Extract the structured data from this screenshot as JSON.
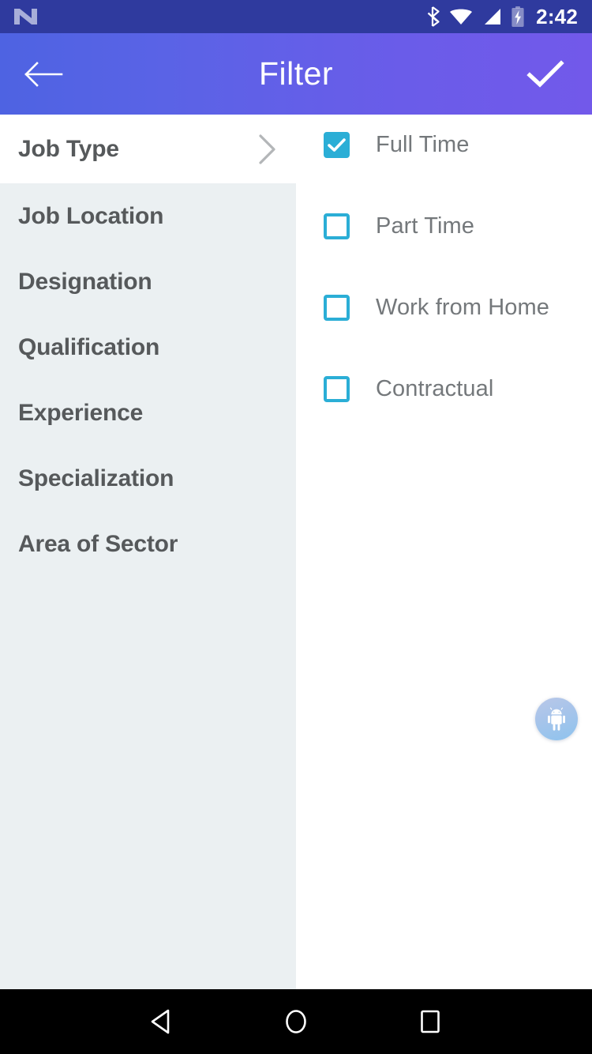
{
  "status_bar": {
    "logo_icon": "android-n-logo-icon",
    "bluetooth_icon": "bluetooth-icon",
    "wifi_icon": "wifi-icon",
    "cellular_icon": "cellular-signal-icon",
    "battery_icon": "battery-charging-icon",
    "clock": "2:42",
    "background_color": "#2f3a9e"
  },
  "app_bar": {
    "title": "Filter",
    "back_icon": "arrow-left-icon",
    "apply_icon": "check-icon",
    "gradient_start": "#4e63e2",
    "gradient_end": "#7259ea"
  },
  "sidebar": {
    "background_color": "#ebf0f2",
    "selected_background_color": "#ffffff",
    "text_color": "#56595b",
    "chevron_icon": "chevron-right-icon",
    "items": [
      {
        "label": "Job Type",
        "selected": true
      },
      {
        "label": "Job Location",
        "selected": false
      },
      {
        "label": "Designation",
        "selected": false
      },
      {
        "label": "Qualification",
        "selected": false
      },
      {
        "label": "Experience",
        "selected": false
      },
      {
        "label": "Specialization",
        "selected": false
      },
      {
        "label": "Area of Sector",
        "selected": false
      }
    ]
  },
  "options_panel": {
    "accent_color": "#2baed6",
    "text_color": "#74787b",
    "options": [
      {
        "label": "Full Time",
        "checked": true
      },
      {
        "label": "Part Time",
        "checked": false
      },
      {
        "label": "Work from Home",
        "checked": false
      },
      {
        "label": "Contractual",
        "checked": false
      }
    ]
  },
  "floating_button": {
    "icon": "android-robot-icon",
    "gradient_start": "#b9c8e8",
    "gradient_end": "#8ec3ee"
  },
  "nav_bar": {
    "background_color": "#000000",
    "back_icon": "triangle-back-icon",
    "home_icon": "circle-home-icon",
    "recents_icon": "square-recents-icon"
  }
}
